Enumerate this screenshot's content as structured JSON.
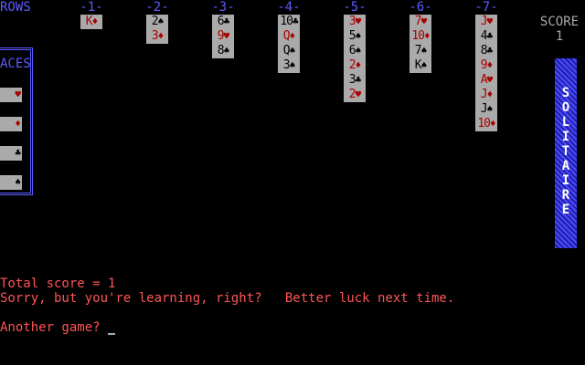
{
  "header": {
    "rows_label": "ROWS"
  },
  "columns": [
    {
      "label": "-1-",
      "cards": [
        {
          "rank": "K",
          "suit": "♦",
          "color": "red"
        }
      ]
    },
    {
      "label": "-2-",
      "cards": [
        {
          "rank": "2",
          "suit": "♠",
          "color": "black"
        },
        {
          "rank": "3",
          "suit": "♦",
          "color": "red"
        }
      ]
    },
    {
      "label": "-3-",
      "cards": [
        {
          "rank": "6",
          "suit": "♣",
          "color": "black"
        },
        {
          "rank": "9",
          "suit": "♥",
          "color": "red"
        },
        {
          "rank": "8",
          "suit": "♠",
          "color": "black"
        }
      ]
    },
    {
      "label": "-4-",
      "cards": [
        {
          "rank": "10",
          "suit": "♣",
          "color": "black"
        },
        {
          "rank": "Q",
          "suit": "♦",
          "color": "red"
        },
        {
          "rank": "Q",
          "suit": "♠",
          "color": "black"
        },
        {
          "rank": "3",
          "suit": "♠",
          "color": "black"
        }
      ]
    },
    {
      "label": "-5-",
      "cards": [
        {
          "rank": "3",
          "suit": "♥",
          "color": "red"
        },
        {
          "rank": "5",
          "suit": "♠",
          "color": "black"
        },
        {
          "rank": "6",
          "suit": "♠",
          "color": "black"
        },
        {
          "rank": "2",
          "suit": "♦",
          "color": "red"
        },
        {
          "rank": "3",
          "suit": "♣",
          "color": "black"
        },
        {
          "rank": "2",
          "suit": "♥",
          "color": "red"
        }
      ]
    },
    {
      "label": "-6-",
      "cards": [
        {
          "rank": "7",
          "suit": "♥",
          "color": "red"
        },
        {
          "rank": "10",
          "suit": "♦",
          "color": "red"
        },
        {
          "rank": "7",
          "suit": "♠",
          "color": "black"
        },
        {
          "rank": "K",
          "suit": "♠",
          "color": "black"
        }
      ]
    },
    {
      "label": "-7-",
      "cards": [
        {
          "rank": "J",
          "suit": "♥",
          "color": "red"
        },
        {
          "rank": "4",
          "suit": "♣",
          "color": "black"
        },
        {
          "rank": "8",
          "suit": "♣",
          "color": "black"
        },
        {
          "rank": "9",
          "suit": "♦",
          "color": "red"
        },
        {
          "rank": "A",
          "suit": "♥",
          "color": "red"
        },
        {
          "rank": "J",
          "suit": "♦",
          "color": "red"
        },
        {
          "rank": "J",
          "suit": "♠",
          "color": "black"
        },
        {
          "rank": "10",
          "suit": "♦",
          "color": "red"
        }
      ]
    }
  ],
  "aces": {
    "label": "ACES",
    "slots": [
      {
        "suit": "♥",
        "color": "red"
      },
      {
        "suit": "♦",
        "color": "red"
      },
      {
        "suit": "♣",
        "color": "black"
      },
      {
        "suit": "♠",
        "color": "black"
      }
    ]
  },
  "score": {
    "label": "SCORE",
    "value": "1"
  },
  "sidebar": {
    "title": "SOLITAIRE"
  },
  "messages": {
    "total": "Total score = 1",
    "sorry": "Sorry, but you're learning, right?   Better luck next time.",
    "prompt": "Another game?"
  },
  "colors": {
    "blue_text": "#5b5bff",
    "red_text": "#ff5555",
    "card_face": "#aaaaaa",
    "red_suit": "#aa0000",
    "black_suit": "#000000"
  }
}
